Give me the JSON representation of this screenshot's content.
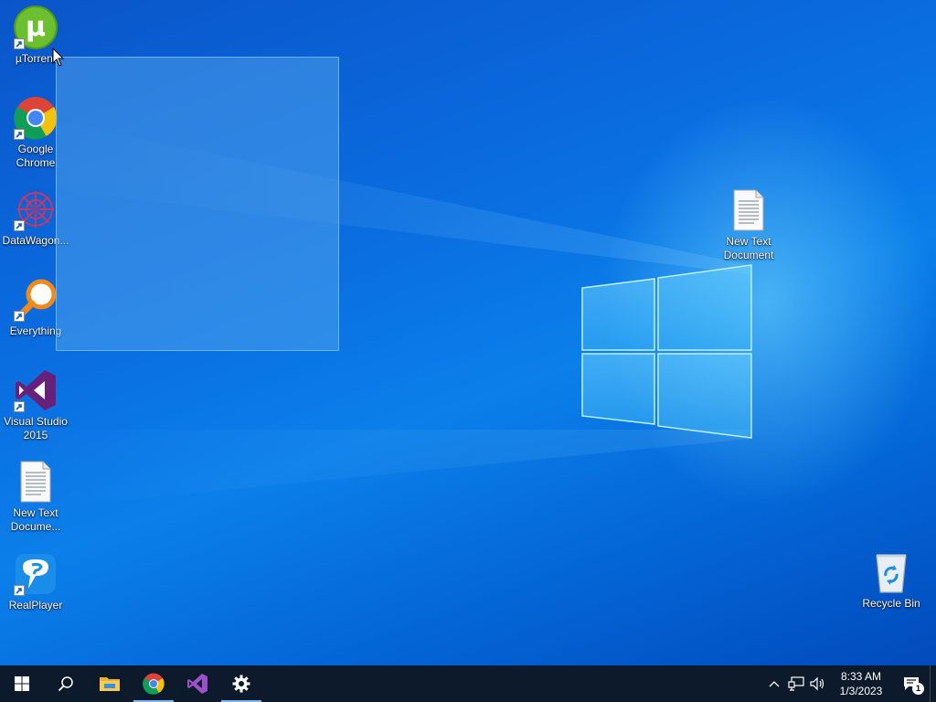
{
  "desktop": {
    "icons": [
      {
        "label": "µTorrent"
      },
      {
        "label": "Google Chrome"
      },
      {
        "label": "DataWagon..."
      },
      {
        "label": "Everything"
      },
      {
        "label": "Visual Studio 2015"
      },
      {
        "label": "New Text Docume..."
      },
      {
        "label": "RealPlayer"
      },
      {
        "label": "New Text Document"
      },
      {
        "label": "Recycle Bin"
      }
    ]
  },
  "taskbar": {
    "pinned": [
      {
        "name": "start",
        "icon": "windows-logo-icon"
      },
      {
        "name": "search",
        "icon": "search-icon"
      },
      {
        "name": "file-explorer",
        "icon": "folder-icon"
      },
      {
        "name": "chrome",
        "icon": "chrome-icon",
        "active": true
      },
      {
        "name": "visual-studio",
        "icon": "visual-studio-icon"
      },
      {
        "name": "settings",
        "icon": "gear-icon",
        "active": true
      }
    ],
    "tray": {
      "time": "8:33 AM",
      "date": "1/3/2023",
      "notification_count": "1"
    }
  },
  "colors": {
    "taskbar": "#0d1a2b",
    "accent": "#7fb6ea"
  }
}
